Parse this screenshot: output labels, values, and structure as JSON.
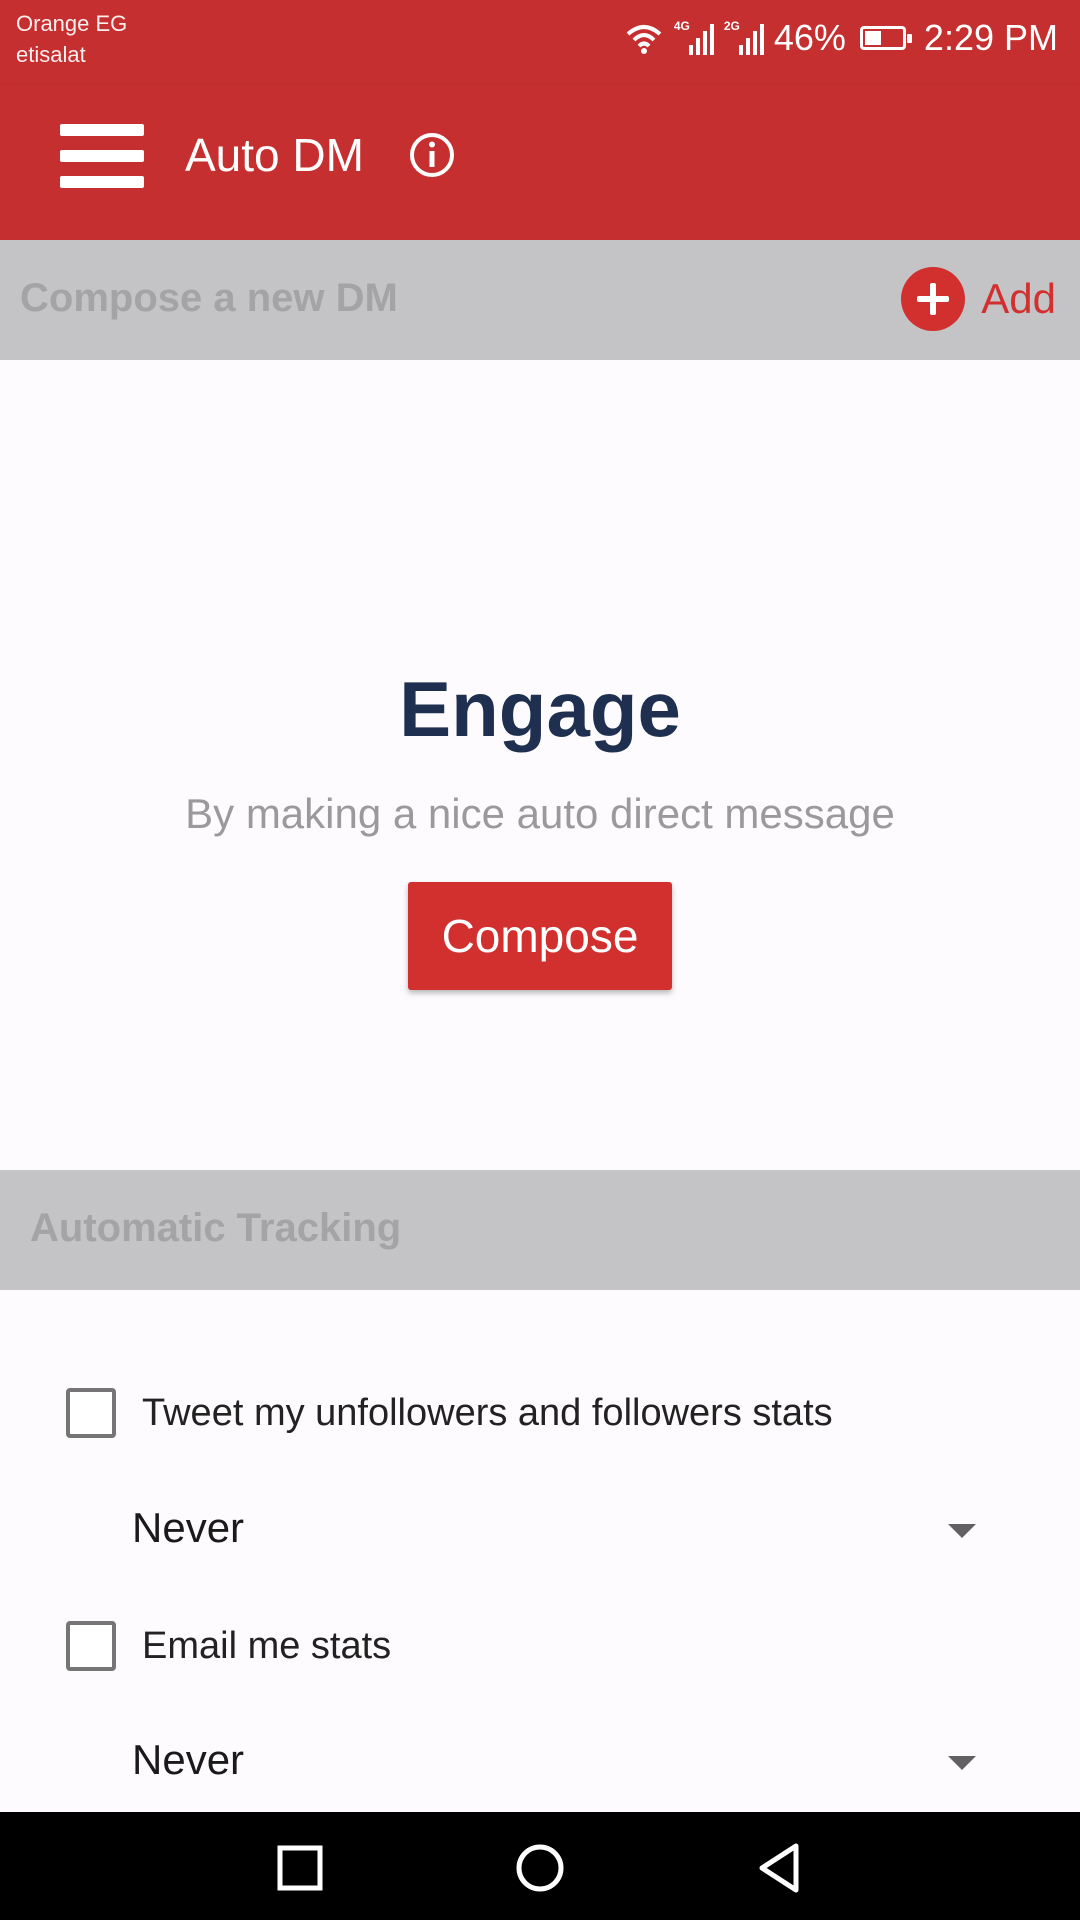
{
  "status_bar": {
    "carrier_1": "Orange EG",
    "carrier_2": "etisalat",
    "sim1_type": "4G",
    "sim2_type": "2G",
    "battery_percent": "46%",
    "battery_level": 0.46,
    "time": "2:29 PM",
    "icons": [
      "wifi-icon",
      "signal-icon",
      "signal-icon",
      "battery-icon"
    ]
  },
  "app_bar": {
    "title": "Auto DM",
    "menu_icon": "hamburger-menu-icon",
    "info_icon": "info-icon"
  },
  "compose_section": {
    "header": "Compose a new DM",
    "add_label": "Add",
    "add_icon": "plus-circle-icon"
  },
  "empty_state": {
    "title": "Engage",
    "subtitle": "By making a nice auto direct message",
    "button_label": "Compose"
  },
  "tracking_section": {
    "header": "Automatic Tracking",
    "options": [
      {
        "label": "Tweet my unfollowers and followers stats",
        "checked": false,
        "frequency": "Never"
      },
      {
        "label": "Email me stats",
        "checked": false,
        "frequency": "Never"
      }
    ]
  },
  "nav_bar": {
    "buttons": [
      "recent-apps-icon",
      "home-icon",
      "back-icon"
    ]
  },
  "colors": {
    "primary": "#c62f2f",
    "accent": "#d1302e",
    "title_text": "#1e2f4f",
    "section_header_bg": "#c4c3c5"
  }
}
